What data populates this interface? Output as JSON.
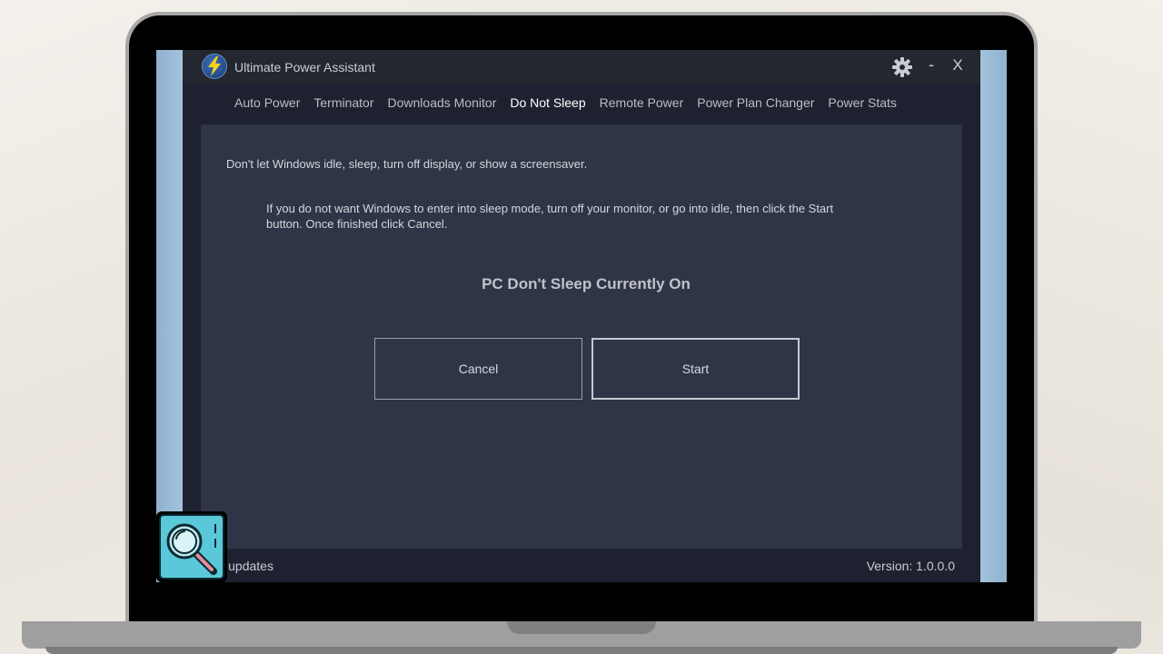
{
  "app": {
    "title": "Ultimate Power Assistant",
    "icons": {
      "logo": "lightning-bolt-icon",
      "settings": "gear-icon",
      "minimize_label": "-",
      "close_label": "X"
    }
  },
  "tabs": [
    {
      "label": "Auto Power",
      "active": false
    },
    {
      "label": "Terminator",
      "active": false
    },
    {
      "label": "Downloads Monitor",
      "active": false
    },
    {
      "label": "Do Not Sleep",
      "active": true
    },
    {
      "label": "Remote Power",
      "active": false
    },
    {
      "label": "Power Plan Changer",
      "active": false
    },
    {
      "label": "Power Stats",
      "active": false
    }
  ],
  "main": {
    "intro": "Don't let Windows idle, sleep, turn off display, or show a screensaver.",
    "description": "If you do not want Windows to enter into sleep mode, turn off your monitor, or go into idle, then click the Start button. Once finished click Cancel.",
    "status": "PC Don't Sleep Currently On",
    "cancel_label": "Cancel",
    "start_label": "Start"
  },
  "footer": {
    "update_link": "k for updates",
    "version": "Version: 1.0.0.0"
  },
  "overlay": {
    "icon": "magnifier-icon"
  },
  "colors": {
    "app_background": "#1e2230",
    "panel_background": "#2f3546",
    "desktop_blue": "#93b6d2",
    "badge_cyan": "#5ac8d8"
  }
}
